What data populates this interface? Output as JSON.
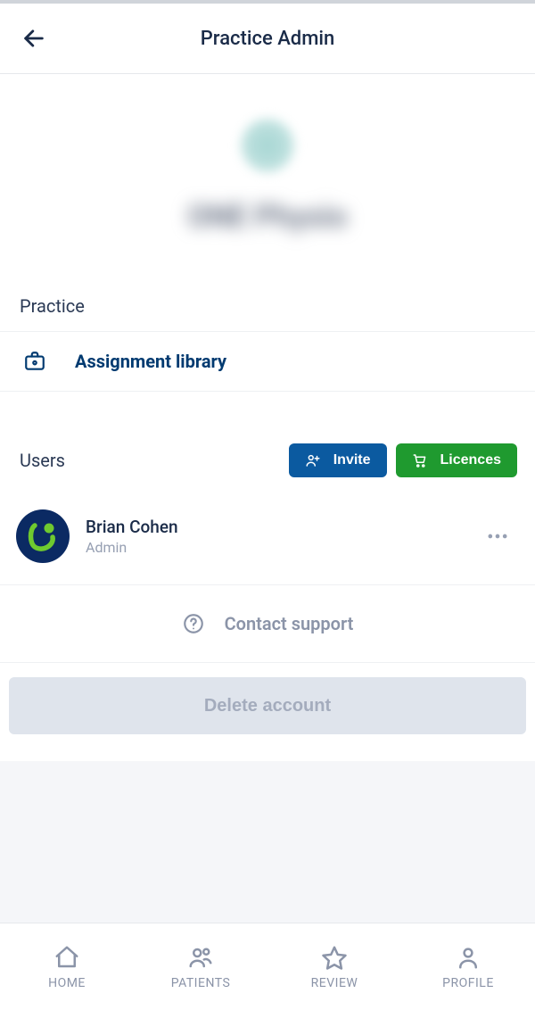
{
  "header": {
    "title": "Practice Admin"
  },
  "banner": {
    "practice_name": "ONE Physio"
  },
  "practice_section": {
    "label": "Practice",
    "items": [
      {
        "label": "Assignment library"
      }
    ]
  },
  "users_section": {
    "label": "Users",
    "invite_label": "Invite",
    "licences_label": "Licences",
    "users": [
      {
        "name": "Brian Cohen",
        "role": "Admin"
      }
    ]
  },
  "support": {
    "label": "Contact support"
  },
  "delete": {
    "label": "Delete account"
  },
  "nav": {
    "items": [
      {
        "label": "HOME"
      },
      {
        "label": "PATIENTS"
      },
      {
        "label": "REVIEW"
      },
      {
        "label": "PROFILE"
      }
    ]
  },
  "colors": {
    "primary_dark": "#003a70",
    "invite_blue": "#0b5aa0",
    "licences_green": "#1f9a2f",
    "avatar_bg": "#0b2a63"
  }
}
